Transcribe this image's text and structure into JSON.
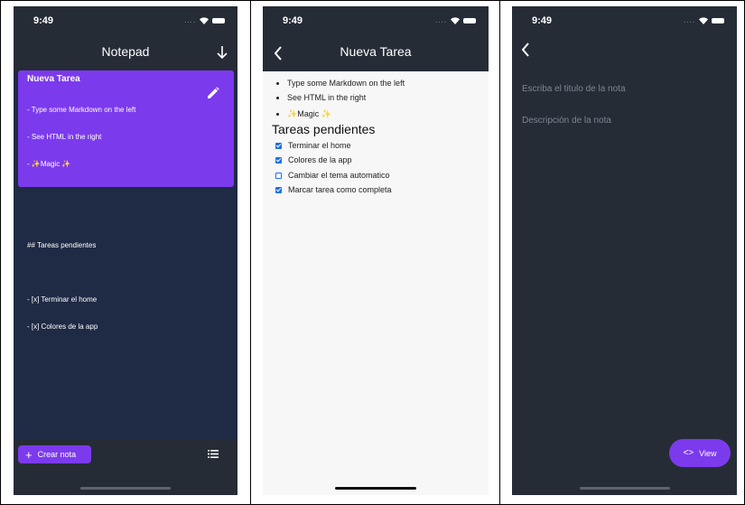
{
  "screens": [
    {
      "status": {
        "time": "9:49"
      },
      "appbar": {
        "title": "Notepad",
        "action_icon": "arrow-down-icon"
      },
      "note": {
        "title": "Nueva Tarea",
        "lines": [
          "- Type some Markdown on the left",
          "- See HTML in the right",
          "- ✨Magic ✨",
          "",
          "",
          "## Tareas pendientes",
          "",
          "- [x] Terminar el home",
          "- [x] Colores de la app"
        ]
      },
      "bottom": {
        "create_label": "Crear nota",
        "list_icon": "list-icon"
      }
    },
    {
      "status": {
        "time": "9:49"
      },
      "appbar": {
        "title": "Nueva Tarea"
      },
      "bullets": [
        "Type some Markdown on the left",
        "See HTML in the right",
        "Magic"
      ],
      "heading": "Tareas pendientes",
      "tasks": [
        {
          "label": "Terminar el home",
          "done": true
        },
        {
          "label": "Colores de la app",
          "done": true
        },
        {
          "label": "Cambiar el tema automatico",
          "done": false
        },
        {
          "label": "Marcar tarea como completa",
          "done": true
        }
      ]
    },
    {
      "status": {
        "time": "9:49"
      },
      "title_placeholder": "Escriba el titulo de la nota",
      "description_placeholder": "Descripción de la nota",
      "view_label": "View"
    }
  ],
  "colors": {
    "accent": "#7c3aed",
    "appbar": "#252c36",
    "list_bg": "#1f2a44",
    "checkbox": "#1f6fe5"
  }
}
